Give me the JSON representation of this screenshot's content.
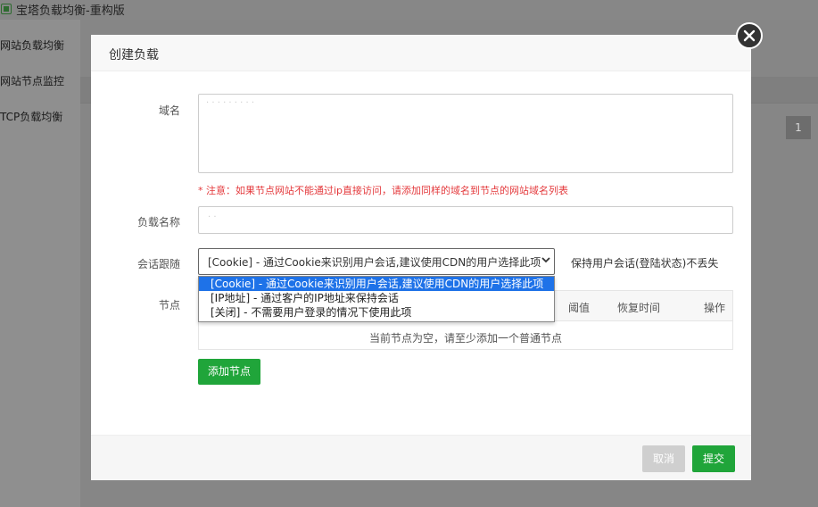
{
  "app": {
    "title": "宝塔负载均衡-重构版",
    "sidebar": {
      "items": [
        {
          "label": "网站负载均衡"
        },
        {
          "label": "网站节点监控"
        },
        {
          "label": "TCP负载均衡"
        }
      ]
    },
    "pagination": {
      "current": "1"
    }
  },
  "modal": {
    "title": "创建负载",
    "close_icon": "close-icon",
    "domain": {
      "label": "域名",
      "value": "· · · · · ·  · ·  ·",
      "note": "* 注意：如果节点网站不能通过ip直接访问，请添加同样的域名到节点的网站域名列表"
    },
    "name": {
      "label": "负载名称",
      "value": "· ·"
    },
    "session": {
      "label": "会话跟随",
      "selected": "[Cookie] - 通过Cookie来识别用户会话,建议使用CDN的用户选择此项",
      "hint": "保持用户会话(登陆状态)不丢失",
      "options": [
        {
          "label": "[Cookie] - 通过Cookie来识别用户会话,建议使用CDN的用户选择此项",
          "selected": true
        },
        {
          "label": "[IP地址] - 通过客户的IP地址来保持会话",
          "selected": false
        },
        {
          "label": "[关闭] - 不需要用户登录的情况下使用此项",
          "selected": false
        }
      ]
    },
    "nodes": {
      "label": "节点",
      "columns": [
        "阈值",
        "恢复时间",
        "操作"
      ],
      "empty_message": "当前节点为空，请至少添加一个普通节点",
      "add_label": "添加节点"
    },
    "footer": {
      "cancel_label": "取消",
      "submit_label": "提交"
    }
  },
  "colors": {
    "accent": "#20a53a",
    "warning": "#e4393c",
    "selected_option": "#1e72e8"
  }
}
